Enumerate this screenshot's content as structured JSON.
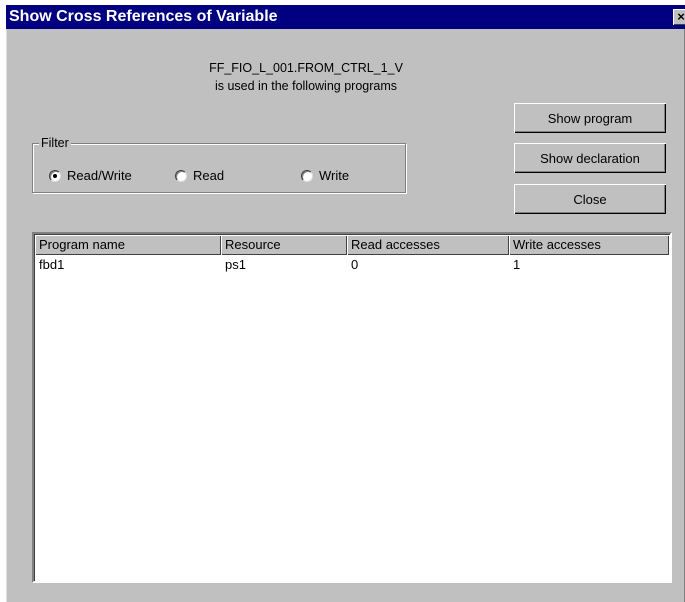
{
  "window": {
    "title": "Show Cross References of Variable",
    "close_label": "×"
  },
  "message": {
    "variable": "FF_FIO_L_001.FROM_CTRL_1_V",
    "text": "is used in the following programs"
  },
  "buttons": {
    "show_program": "Show program",
    "show_declaration": "Show declaration",
    "close": "Close"
  },
  "filter": {
    "label": "Filter",
    "options": [
      {
        "label": "Read/Write",
        "checked": true
      },
      {
        "label": "Read",
        "checked": false
      },
      {
        "label": "Write",
        "checked": false
      }
    ]
  },
  "table": {
    "columns": [
      "Program name",
      "Resource",
      "Read accesses",
      "Write accesses"
    ],
    "rows": [
      [
        "fbd1",
        "ps1",
        "0",
        "1"
      ]
    ]
  }
}
